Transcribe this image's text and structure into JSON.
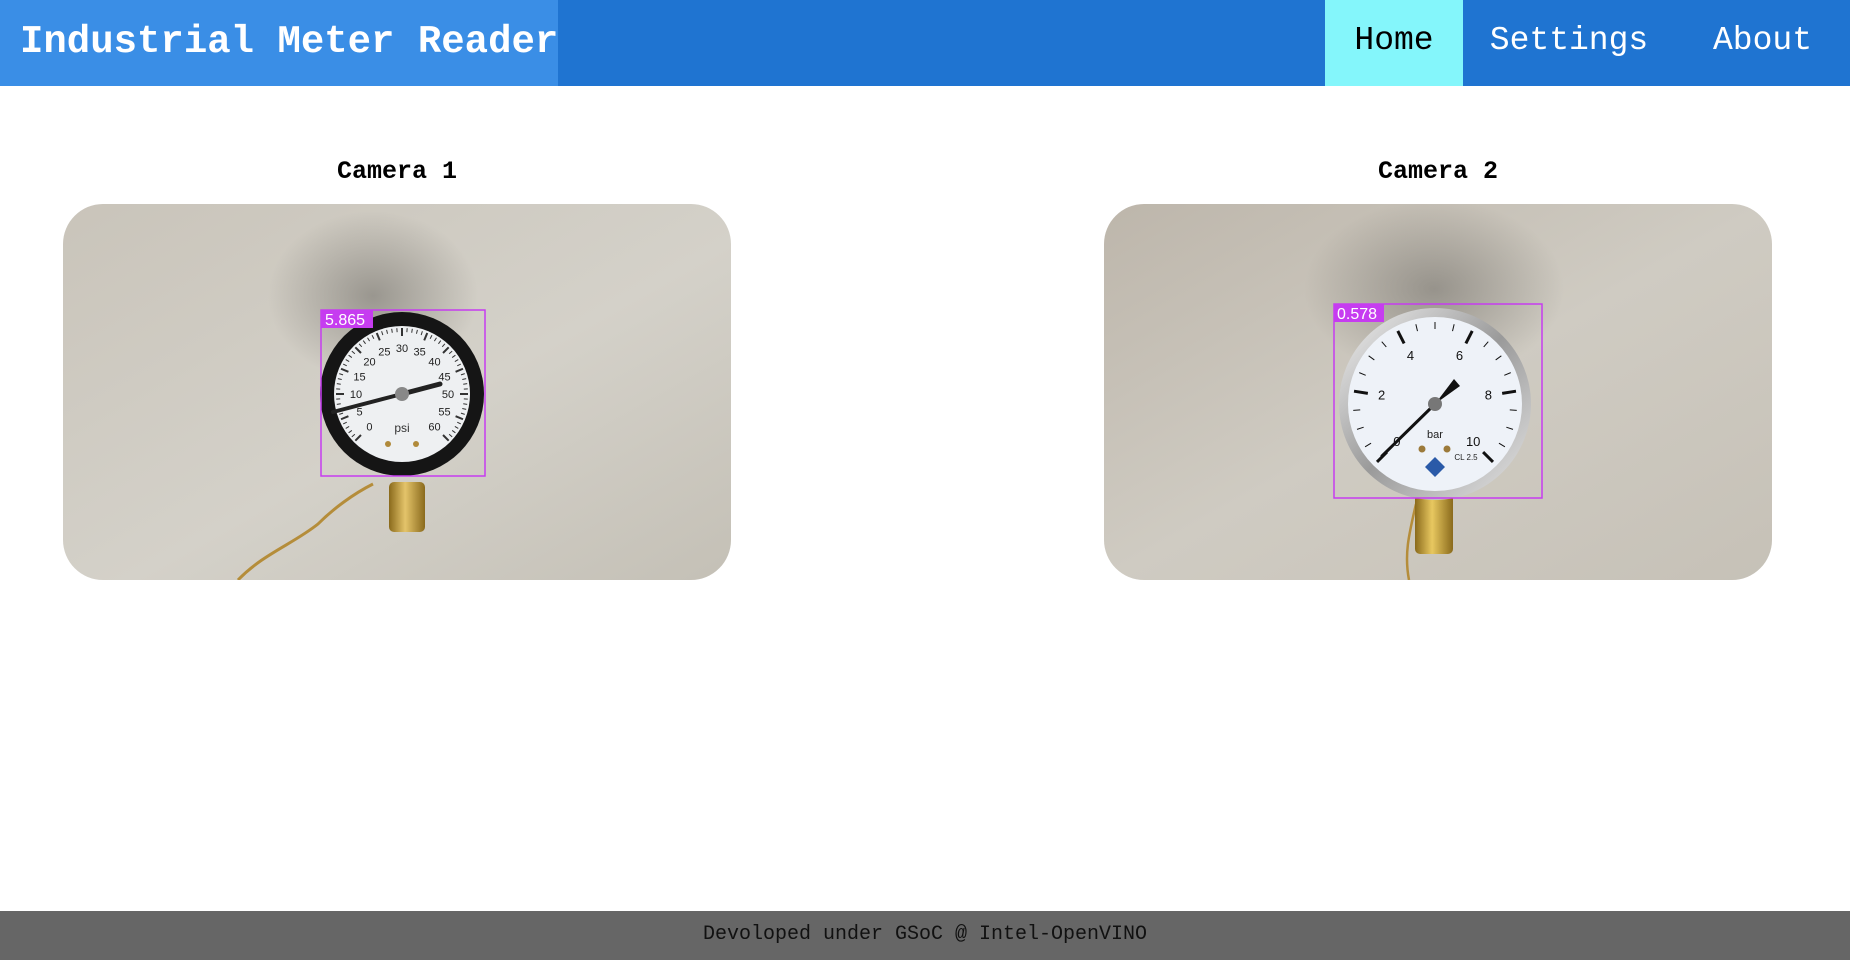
{
  "app": {
    "title": "Industrial Meter Reader"
  },
  "nav": {
    "items": [
      {
        "label": "Home"
      },
      {
        "label": "Settings"
      },
      {
        "label": "About"
      }
    ]
  },
  "cameras": [
    {
      "title": "Camera 1",
      "reading": "5.865",
      "gauge_unit": "psi",
      "dial_labels": [
        "0",
        "5",
        "10",
        "15",
        "20",
        "25",
        "30",
        "35",
        "40",
        "45",
        "50",
        "55",
        "60"
      ]
    },
    {
      "title": "Camera 2",
      "reading": "0.578",
      "gauge_unit": "bar",
      "gauge_class": "CL 2.5",
      "dial_labels": [
        "0",
        "2",
        "4",
        "6",
        "8",
        "10"
      ]
    }
  ],
  "footer": {
    "text": "Devoloped under GSoC @ Intel-OpenVINO"
  },
  "colors": {
    "header": "#1f74d1",
    "brand": "#3a8ee6",
    "active_tab": "#84f6fb",
    "footer": "#666666",
    "detection_box": "#c63cf0"
  }
}
